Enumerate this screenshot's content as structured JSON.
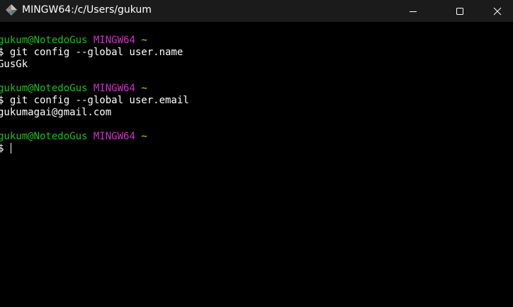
{
  "window": {
    "title": "MINGW64:/c/Users/gukum",
    "app_icon": "git-bash-diamond-icon",
    "controls": [
      "minimize-icon",
      "maximize-icon",
      "close-icon"
    ]
  },
  "colors": {
    "background": "#000000",
    "titlebar": "#1b1b1b",
    "user_host": "#1fbc1f",
    "system": "#c437c4",
    "path": "#c8c81f",
    "text": "#ffffff"
  },
  "terminal": {
    "blocks": [
      {
        "user_host": "gukum@NotedoGus",
        "system": "MINGW64",
        "path": "~",
        "command": "$ git config --global user.name",
        "output": "GusGk"
      },
      {
        "user_host": "gukum@NotedoGus",
        "system": "MINGW64",
        "path": "~",
        "command": "$ git config --global user.email",
        "output": "gukumagai@gmail.com"
      },
      {
        "user_host": "gukum@NotedoGus",
        "system": "MINGW64",
        "path": "~",
        "command": "$ "
      }
    ]
  }
}
